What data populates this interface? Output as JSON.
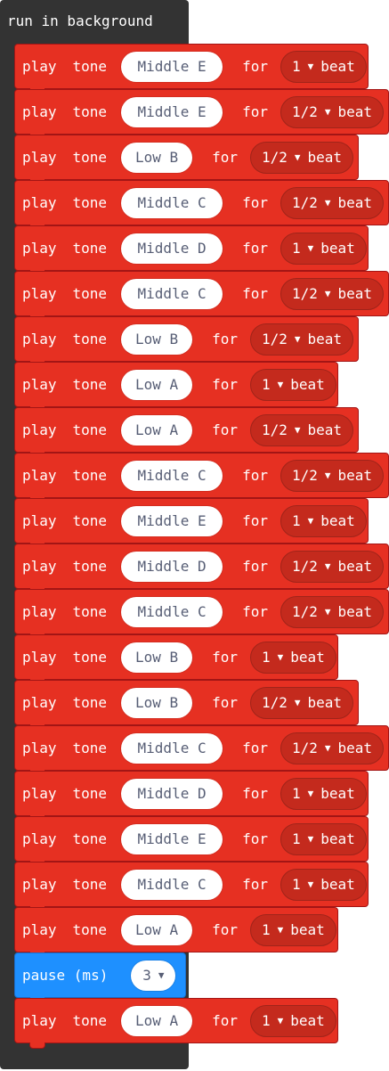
{
  "container": {
    "title": "run in background"
  },
  "labels": {
    "play": "play",
    "tone": "tone",
    "for": "for",
    "beat": "beat",
    "arrow": "▼"
  },
  "blocks": [
    {
      "type": "tone",
      "note": "Middle E",
      "duration": "1"
    },
    {
      "type": "tone",
      "note": "Middle E",
      "duration": "1/2"
    },
    {
      "type": "tone",
      "note": "Low B",
      "duration": "1/2"
    },
    {
      "type": "tone",
      "note": "Middle C",
      "duration": "1/2"
    },
    {
      "type": "tone",
      "note": "Middle D",
      "duration": "1"
    },
    {
      "type": "tone",
      "note": "Middle C",
      "duration": "1/2"
    },
    {
      "type": "tone",
      "note": "Low B",
      "duration": "1/2"
    },
    {
      "type": "tone",
      "note": "Low A",
      "duration": "1"
    },
    {
      "type": "tone",
      "note": "Low A",
      "duration": "1/2"
    },
    {
      "type": "tone",
      "note": "Middle C",
      "duration": "1/2"
    },
    {
      "type": "tone",
      "note": "Middle E",
      "duration": "1"
    },
    {
      "type": "tone",
      "note": "Middle D",
      "duration": "1/2"
    },
    {
      "type": "tone",
      "note": "Middle C",
      "duration": "1/2"
    },
    {
      "type": "tone",
      "note": "Low B",
      "duration": "1"
    },
    {
      "type": "tone",
      "note": "Low B",
      "duration": "1/2"
    },
    {
      "type": "tone",
      "note": "Middle C",
      "duration": "1/2"
    },
    {
      "type": "tone",
      "note": "Middle D",
      "duration": "1"
    },
    {
      "type": "tone",
      "note": "Middle E",
      "duration": "1"
    },
    {
      "type": "tone",
      "note": "Middle C",
      "duration": "1"
    },
    {
      "type": "tone",
      "note": "Low A",
      "duration": "1"
    },
    {
      "type": "pause",
      "label": "pause (ms)",
      "value": "3"
    },
    {
      "type": "tone",
      "note": "Low A",
      "duration": "1"
    }
  ],
  "colors": {
    "tone_block": "#e63022",
    "pause_block": "#1e90ff",
    "container": "#333333"
  }
}
